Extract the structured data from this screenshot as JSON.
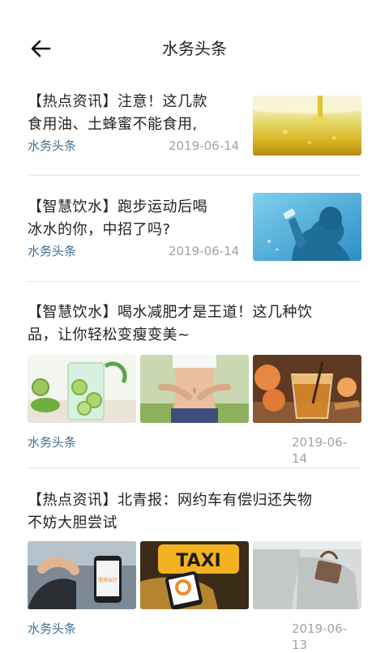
{
  "header": {
    "title": "水务头条",
    "back_icon": "arrow-left-icon"
  },
  "articles": [
    {
      "title_line1": "【热点资讯】注意！这几款",
      "title_line2": "食用油、土蜂蜜不能食用,",
      "source": "水务头条",
      "date": "2019-06-14",
      "images": [
        "cooking-oil-pour-image"
      ]
    },
    {
      "title_line1": "【智慧饮水】跑步运动后喝",
      "title_line2": "冰水的你，中招了吗?",
      "source": "水务头条",
      "date": "2019-06-14",
      "images": [
        "man-drinking-water-image"
      ]
    },
    {
      "title_line1": "【智慧饮水】喝水减肥才是王道！这几种饮",
      "title_line2": "品，让你轻松变瘦变美~",
      "source": "水务头条",
      "date": "2019-06-14",
      "images": [
        "cucumber-water-image",
        "slim-waist-image",
        "peach-tea-image"
      ]
    },
    {
      "title_line1": "【热点资讯】北青报：网约车有偿归还失物",
      "title_line2": "不妨大胆尝试",
      "source": "水务头条",
      "date": "2019-06-13",
      "images": [
        "phone-in-car-image",
        "taxi-sign-image",
        "car-seat-bag-image"
      ],
      "taxi_sign_text": "TAXI",
      "app_screen_text": "滴滴出行"
    }
  ]
}
